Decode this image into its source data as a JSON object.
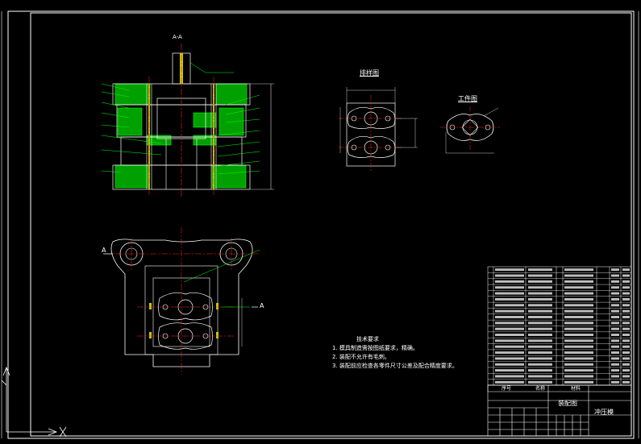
{
  "drawing": {
    "section_label": "A-A",
    "blank_view_title": "排样图",
    "part_view_title": "工件图",
    "view_marker": "A",
    "view_marker_right": "A",
    "sheet_title": "装配图",
    "product_name": "冲压模"
  },
  "technical_requirements": {
    "title": "技术要求",
    "items": [
      "1. 模具制造需按图纸要求，精确。",
      "2. 装配不允许有毛刺。",
      "3. 装配前应检查各零件尺寸公差及配合精度要求。"
    ]
  },
  "bom": {
    "footer_labels": [
      "序号",
      "名称",
      "材料"
    ],
    "row_count": 20
  },
  "colors": {
    "background": "#000000",
    "frame": "#ffffff",
    "center_line": "#ff2020",
    "section_fill": "#00c800",
    "outline": "#ffffff",
    "dimension": "#00c800",
    "leader": "#00ff00"
  }
}
